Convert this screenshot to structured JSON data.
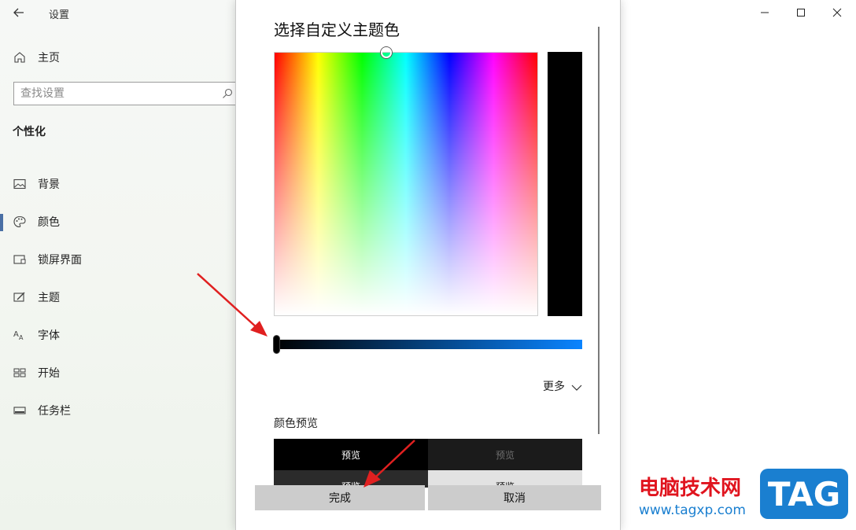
{
  "window": {
    "title": "设置",
    "controls": [
      "minimize-icon",
      "maximize-icon",
      "close-icon"
    ]
  },
  "sidebar": {
    "home_label": "主页",
    "search_placeholder": "查找设置",
    "section_title": "个性化",
    "items": [
      {
        "label": "背景",
        "icon": "image-icon",
        "active": false
      },
      {
        "label": "颜色",
        "icon": "palette-icon",
        "active": true
      },
      {
        "label": "锁屏界面",
        "icon": "lock-screen-icon",
        "active": false
      },
      {
        "label": "主题",
        "icon": "theme-brush-icon",
        "active": false
      },
      {
        "label": "字体",
        "icon": "font-icon",
        "active": false
      },
      {
        "label": "开始",
        "icon": "start-icon",
        "active": false
      },
      {
        "label": "任务栏",
        "icon": "taskbar-icon",
        "active": false
      }
    ]
  },
  "dialog": {
    "title": "选择自定义主题色",
    "selected_color": "#000000",
    "slider_end_color": "#0a84ff",
    "value_slider_level": 0,
    "more_label": "更多",
    "preview_title": "颜色预览",
    "preview_cells": [
      "预览",
      "预览",
      "预览",
      "预览"
    ],
    "done_label": "完成",
    "cancel_label": "取消"
  },
  "watermark": {
    "site_name": "电脑技术网",
    "url": "www.tagxp.com",
    "logo_text": "TAG"
  },
  "annotation_color": "#e02020"
}
